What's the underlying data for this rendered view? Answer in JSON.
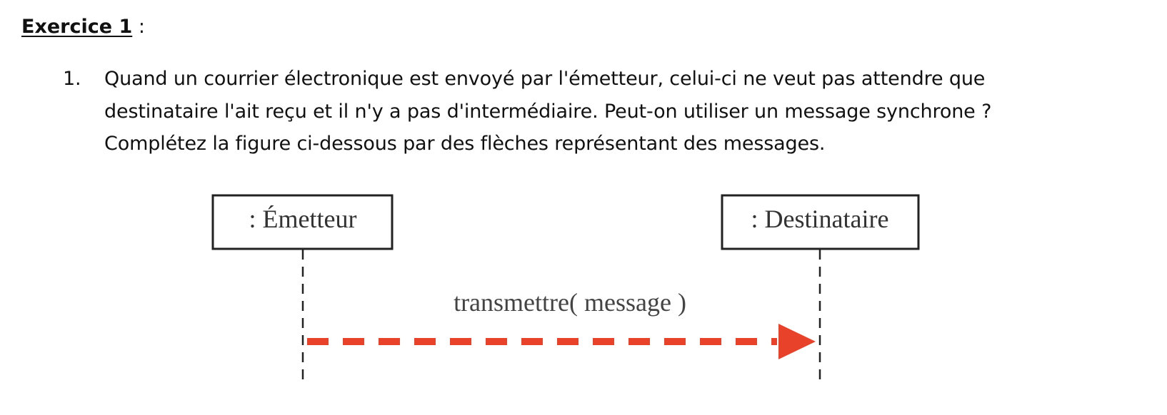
{
  "exercise": {
    "title": "Exercice 1",
    "suffix": " :"
  },
  "question": {
    "number": "1.",
    "lines": [
      "Quand un courrier électronique est envoyé par l'émetteur, celui-ci ne veut pas attendre que",
      "destinataire l'ait reçu et il n'y a pas d'intermédiaire. Peut-on utiliser un message synchrone ?",
      "Complétez la figure ci-dessous par des flèches représentant des messages."
    ]
  },
  "diagram": {
    "lifelines": [
      {
        "label": ": Émetteur"
      },
      {
        "label": ": Destinataire"
      }
    ],
    "message": {
      "label": "transmettre( message )",
      "color": "#e8432a",
      "style": "dashed",
      "direction": "Émetteur → Destinataire"
    },
    "colors": {
      "stroke": "#222222",
      "arrow": "#e8432a"
    }
  }
}
